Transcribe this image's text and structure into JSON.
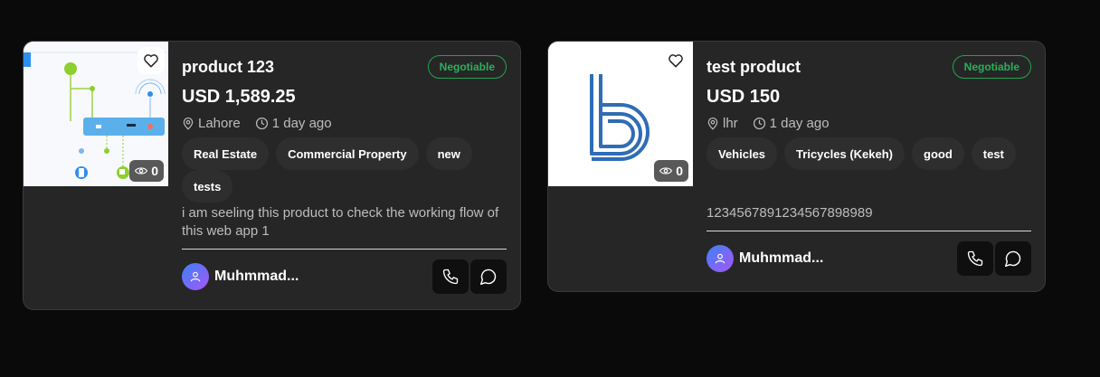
{
  "listings": [
    {
      "title": "product 123",
      "badge": "Negotiable",
      "price": "USD 1,589.25",
      "location": "Lahore",
      "time": "1 day ago",
      "views": "0",
      "tags": [
        "Real Estate",
        "Commercial Property",
        "new",
        "tests"
      ],
      "description": "i am seeling this product to check the working flow of this web app 1",
      "owner": "Muhmmad..."
    },
    {
      "title": "test product",
      "badge": "Negotiable",
      "price": "USD 150",
      "location": "lhr",
      "time": "1 day ago",
      "views": "0",
      "tags": [
        "Vehicles",
        "Tricycles (Kekeh)",
        "good",
        "test"
      ],
      "description": "1234567891234567898989",
      "owner": "Muhmmad..."
    }
  ],
  "colors": {
    "page_bg": "#0a0a0a",
    "card_bg": "#262626",
    "negotiable": "#2bb05a",
    "logo_blue": "#2f6db5"
  },
  "icons": [
    "heart-icon",
    "eye-icon",
    "location-pin-icon",
    "clock-icon",
    "user-icon",
    "phone-icon",
    "chat-icon"
  ]
}
